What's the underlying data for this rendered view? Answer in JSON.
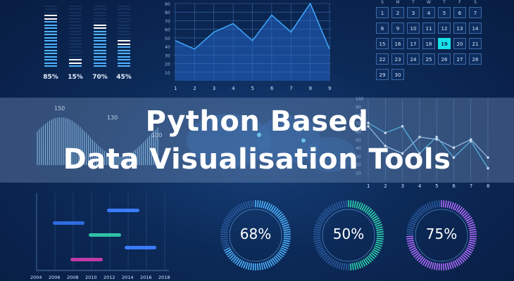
{
  "title": {
    "line1": "Python Based",
    "line2": "Data Visualisation Tools"
  },
  "colors": {
    "background": "#0c2a58",
    "accent": "#19e0e8",
    "line": "#3fa9ff",
    "bar": "#6fc3ff"
  },
  "progress_bars": [
    {
      "label": "85%",
      "value": 0.85
    },
    {
      "label": "15%",
      "value": 0.15
    },
    {
      "label": "70%",
      "value": 0.7
    },
    {
      "label": "45%",
      "value": 0.45
    }
  ],
  "line_chart": {
    "x_ticks": [
      "1",
      "2",
      "3",
      "4",
      "5",
      "6",
      "7",
      "8",
      "9"
    ],
    "y_ticks": [
      "90",
      "80",
      "70",
      "60",
      "50",
      "40",
      "30",
      "20",
      "10"
    ],
    "values": [
      52,
      41,
      63,
      74,
      52,
      85,
      63,
      100,
      41
    ]
  },
  "calendar": {
    "weekdays": [
      "S",
      "M",
      "T",
      "W",
      "T",
      "F",
      "S"
    ],
    "weeks": [
      [
        "1",
        "2",
        "3",
        "4",
        "5",
        "6",
        "7"
      ],
      [
        "8",
        "9",
        "10",
        "11",
        "12",
        "13",
        "14"
      ],
      [
        "15",
        "16",
        "17",
        "18",
        "19",
        "20",
        "21"
      ],
      [
        "22",
        "23",
        "24",
        "25",
        "26",
        "27",
        "28"
      ],
      [
        "29",
        "30",
        "",
        "",
        "",
        "",
        ""
      ]
    ],
    "highlight": "19"
  },
  "wave_chart": {
    "labels": [
      "150",
      "130",
      "100"
    ]
  },
  "multi_line_chart": {
    "x_ticks": [
      "1",
      "2",
      "3",
      "4",
      "5",
      "6",
      "7",
      "8"
    ],
    "y_ticks": [
      "100",
      "90",
      "80",
      "70",
      "60",
      "50",
      "40",
      "30",
      "20",
      "10"
    ],
    "series": [
      {
        "values": [
          70,
          58,
          66,
          33,
          53,
          28,
          48,
          15
        ]
      },
      {
        "values": [
          66,
          42,
          33,
          53,
          50,
          40,
          50,
          28
        ]
      }
    ]
  },
  "gantt": {
    "x_ticks": [
      "2004",
      "2006",
      "2008",
      "2010",
      "2012",
      "2014",
      "2016",
      "2018"
    ]
  },
  "donuts": [
    {
      "label": "68%",
      "value": 0.68
    },
    {
      "label": "50%",
      "value": 0.5
    },
    {
      "label": "75%",
      "value": 0.75
    }
  ]
}
